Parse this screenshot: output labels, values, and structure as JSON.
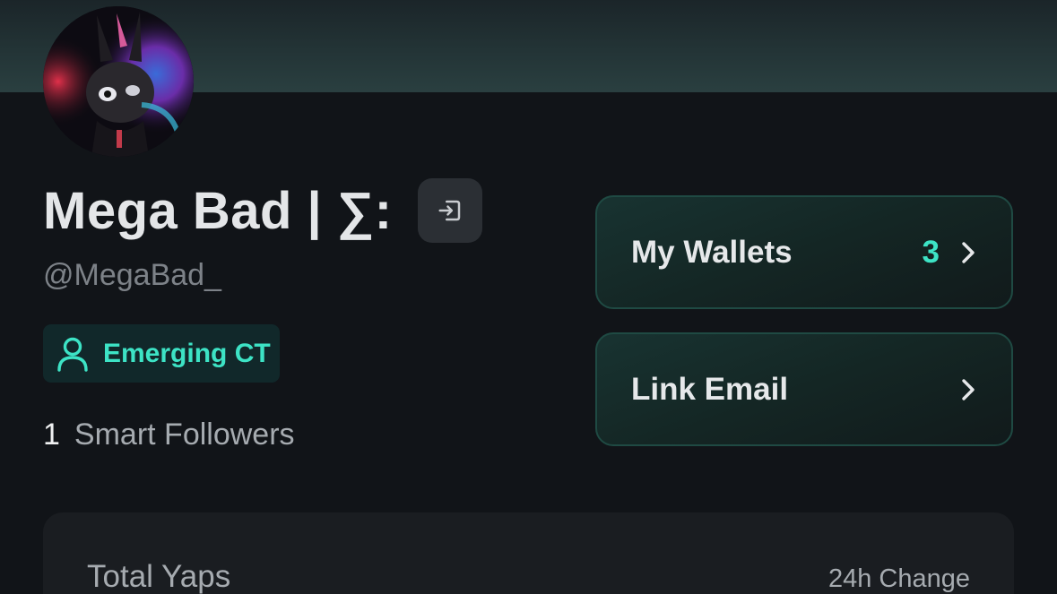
{
  "profile": {
    "display_name": "Mega Bad | ∑:",
    "handle": "@MegaBad_",
    "badge_label": "Emerging CT",
    "smart_followers_count": "1",
    "smart_followers_label": "Smart Followers"
  },
  "actions": {
    "wallets_label": "My Wallets",
    "wallets_count": "3",
    "email_label": "Link Email"
  },
  "stats": {
    "total_label": "Total Yaps",
    "change_label": "24h Change"
  },
  "icons": {
    "logout": "logout-icon",
    "badge": "user-icon",
    "chevron": "chevron-right-icon"
  },
  "colors": {
    "accent": "#3de3c5",
    "background": "#111418",
    "card_border": "#1f4a43"
  }
}
